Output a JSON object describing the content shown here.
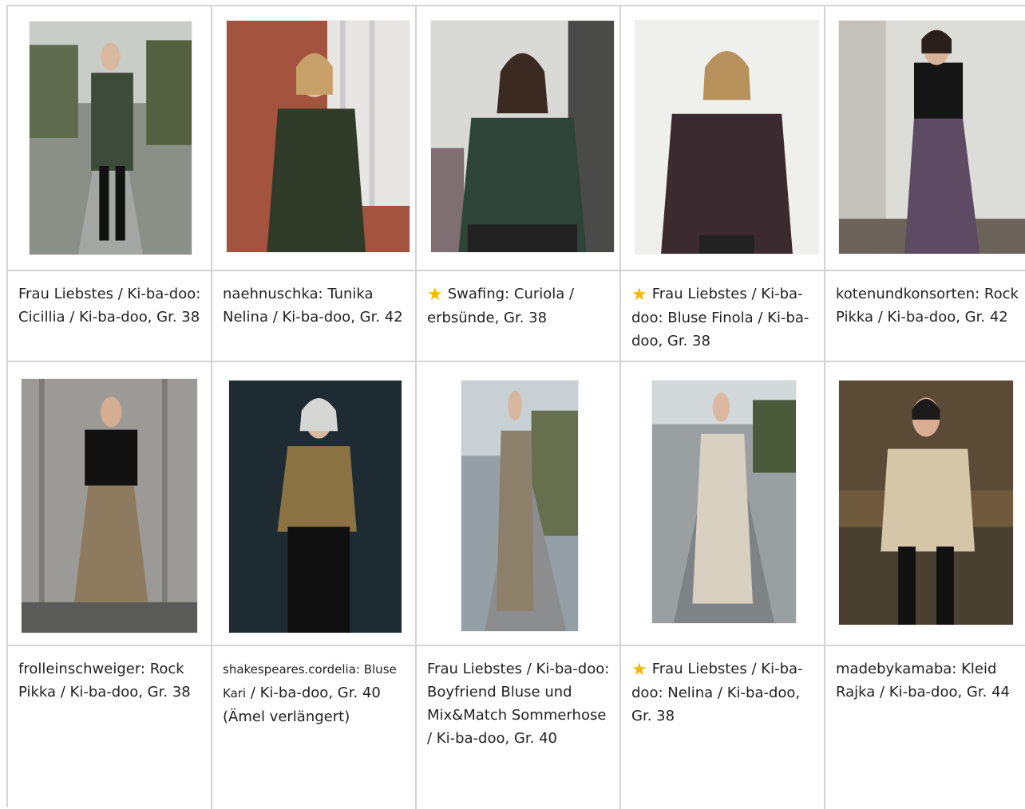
{
  "gallery": {
    "row1": [
      {
        "caption": "Frau Liebstes / Ki-ba-doo: Cicillia / Ki-ba-doo, Gr. 38",
        "starred": false
      },
      {
        "caption": "naehnuschka: Tunika Nelina / Ki-ba-doo, Gr. 42",
        "starred": false
      },
      {
        "caption": "Swafing: Curiola / erbsünde, Gr. 38",
        "starred": true
      },
      {
        "caption": "Frau Liebstes / Ki-ba-doo: Bluse Finola / Ki-ba-doo, Gr. 38",
        "starred": true
      },
      {
        "caption": "kotenundkonsorten: Rock Pikka / Ki-ba-doo, Gr. 42",
        "starred": false
      }
    ],
    "row2": [
      {
        "caption": "frolleinschweiger: Rock Pikka / Ki-ba-doo, Gr. 38",
        "starred": false
      },
      {
        "caption_small": "shakespeares.cordelia: Bluse Kari",
        "caption": " / Ki-ba-doo, Gr. 40 (Ämel verlängert)",
        "starred": false
      },
      {
        "caption": "Frau Liebstes / Ki-ba-doo: Boyfriend Bluse und Mix&Match Sommerhose / Ki-ba-doo, Gr. 40",
        "starred": false
      },
      {
        "caption": "Frau Liebstes / Ki-ba-doo: Nelina / Ki-ba-doo, Gr. 38",
        "starred": true
      },
      {
        "caption": "madebykamaba: Kleid Rajka / Ki-ba-doo, Gr. 44",
        "starred": false
      }
    ],
    "star_icon": "star-icon",
    "colors": {
      "border": "#d4d4d4",
      "star": "#f5b800"
    }
  }
}
